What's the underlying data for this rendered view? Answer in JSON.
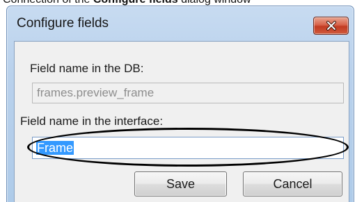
{
  "document": {
    "cut_text_plain": "Connection of the ",
    "cut_text_bold": "Configure fields",
    "cut_text_tail": " dialog window"
  },
  "dialog": {
    "title": "Configure fields",
    "close_icon": "close-x-icon",
    "db_field": {
      "label": "Field name in the DB:",
      "value": "frames.preview_frame"
    },
    "ui_field": {
      "label": "Field name in the interface:",
      "value": "Frame"
    },
    "buttons": {
      "save": "Save",
      "cancel": "Cancel"
    }
  },
  "colors": {
    "title_bar": "#b9d1ec",
    "close_button": "#c23b22",
    "selection": "#3399ff",
    "annotation": "#000000"
  }
}
